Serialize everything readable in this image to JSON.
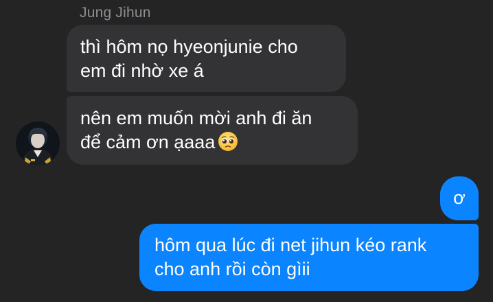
{
  "conversation": {
    "sender_name": "Jung Jihun",
    "messages": [
      {
        "direction": "incoming",
        "lines": [
          "thì hôm nọ hyeonjunie cho",
          "em đi nhờ xe á"
        ]
      },
      {
        "direction": "incoming",
        "lines": [
          "nên em muốn mời anh đi ăn",
          "để cảm ơn ạaaa"
        ],
        "emoji": "pleading-face-emoji"
      },
      {
        "direction": "outgoing",
        "lines": [
          "ơ"
        ]
      },
      {
        "direction": "outgoing",
        "lines": [
          "hôm qua lúc đi net jihun kéo rank",
          "cho anh rồi còn gìii"
        ]
      }
    ]
  },
  "colors": {
    "background": "#242424",
    "incoming_bubble": "#333335",
    "outgoing_bubble": "#0a84ff",
    "sender_name": "#8e8e93",
    "text": "#ffffff"
  },
  "icons": {
    "avatar": "contact-avatar-photo",
    "emoji": "pleading-face-emoji"
  }
}
